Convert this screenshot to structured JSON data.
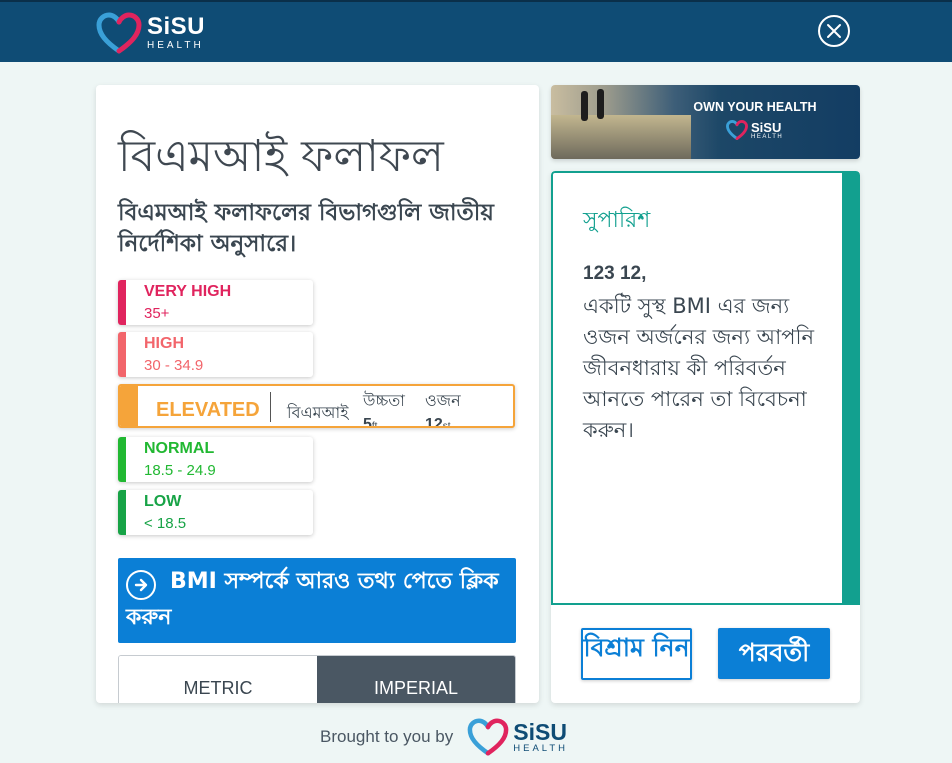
{
  "header": {
    "logo_name": "SiSU",
    "logo_sub": "HEALTH",
    "close_icon": "close-icon"
  },
  "results": {
    "title": "বিএমআই ফলাফল",
    "subtitle": "বিএমআই ফলাফলের বিভাগগুলি জাতীয় নির্দেশিকা অনুসারে।",
    "categories": [
      {
        "name": "VERY HIGH",
        "range": "35+",
        "color": "#e0245e"
      },
      {
        "name": "HIGH",
        "range": "30 - 34.9",
        "color": "#f2656b"
      },
      {
        "name": "ELEVATED",
        "color": "#f5a43a",
        "selected": true
      },
      {
        "name": "NORMAL",
        "range": "18.5 - 24.9",
        "color": "#21b832"
      },
      {
        "name": "LOW",
        "range": "< 18.5",
        "color": "#17a346"
      }
    ],
    "elevated_details": {
      "bmi_label": "বিএমআই",
      "height_label": "উচ্চতা",
      "height_value": "5",
      "height_unit": "ft",
      "weight_label": "ওজন",
      "weight_value": "12",
      "weight_unit": "st"
    },
    "info_button": "BMI সম্পর্কে আরও তথ্য পেতে ক্লিক করুন",
    "info_icon": "arrow-circle-icon",
    "unit_toggle": {
      "metric": "METRIC",
      "imperial": "IMPERIAL",
      "selected": "IMPERIAL"
    }
  },
  "banner": {
    "title": "OWN YOUR HEALTH",
    "logo_name": "SiSU",
    "logo_sub": "HEALTH"
  },
  "recommendation": {
    "title": "সুপারিশ",
    "user_name": "123 12,",
    "text": "একটি সুস্থ BMI এর জন্য ওজন অর্জনের জন্য আপনি জীবনধারায় কী পরিবর্তন আনতে পারেন তা বিবেচনা করুন।",
    "rest_button": "বিশ্রাম নিন",
    "next_button": "পরবর্তী"
  },
  "footer": {
    "text": "Brought to you by",
    "logo_name": "SiSU",
    "logo_sub": "HEALTH"
  },
  "colors": {
    "brand_navy": "#0f4c75",
    "accent_blue": "#0b7fd6",
    "teal": "#12a08f",
    "heart_red": "#e0245e",
    "heart_blue": "#3aa0d8"
  }
}
